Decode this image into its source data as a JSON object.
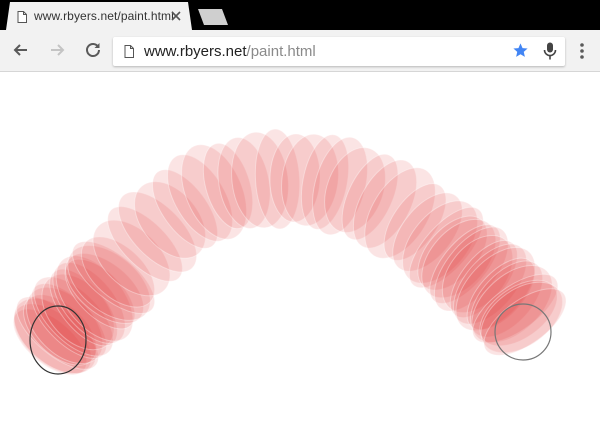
{
  "tab": {
    "title": "www.rbyers.net/paint.html",
    "icon": "page-icon",
    "close_icon": "close-icon"
  },
  "toolbar": {
    "back_icon": "back-arrow-icon",
    "forward_icon": "forward-arrow-icon",
    "reload_icon": "reload-icon",
    "menu_icon": "more-vert-icon"
  },
  "omnibox": {
    "host": "www.rbyers.net",
    "path": "/paint.html",
    "page_icon": "page-icon",
    "star_icon": "star-icon",
    "mic_icon": "mic-icon"
  },
  "colors": {
    "stroke": "#e03232",
    "star": "#4285f4"
  }
}
